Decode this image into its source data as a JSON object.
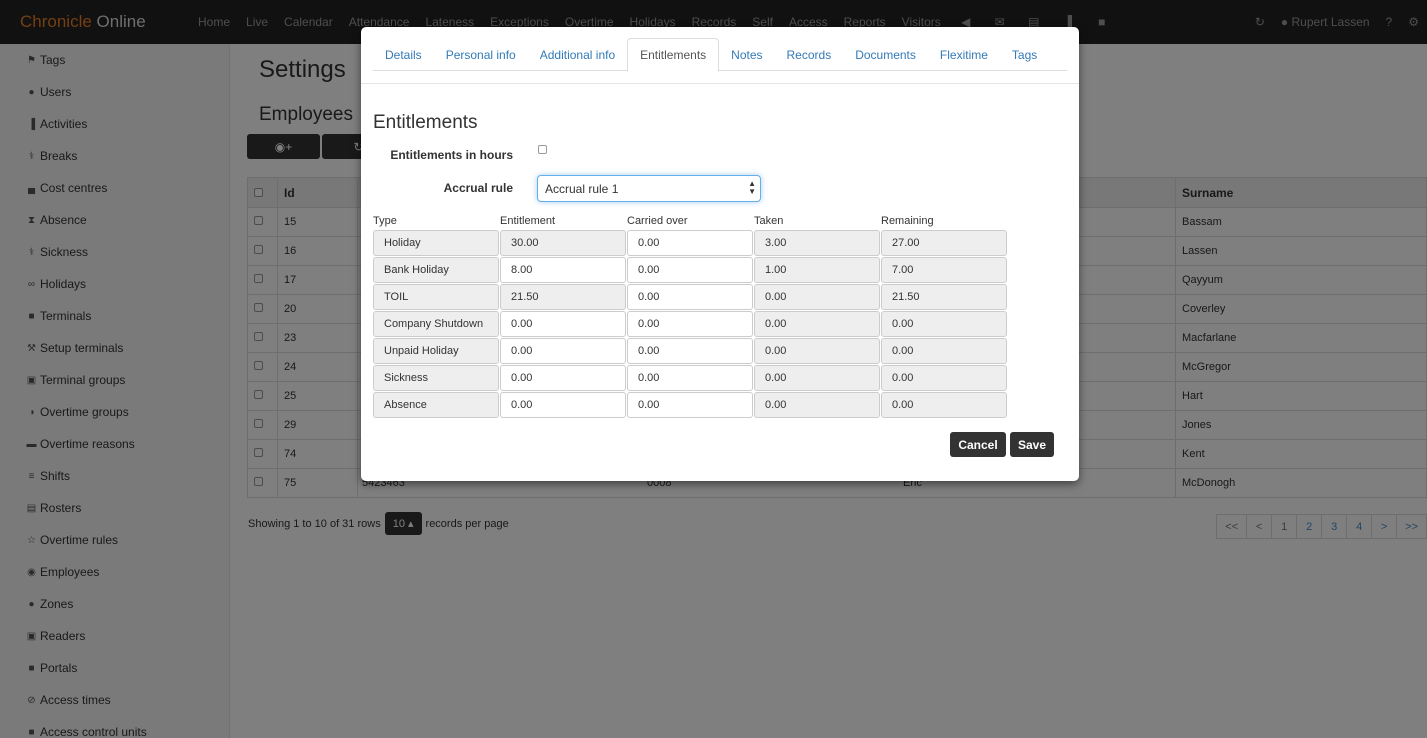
{
  "navbar": {
    "brand_main": "Chronicle",
    "brand_sub": "Online",
    "items": [
      "Home",
      "Live",
      "Calendar",
      "Attendance",
      "Lateness",
      "Exceptions",
      "Overtime",
      "Holidays",
      "Records",
      "Self",
      "Access",
      "Reports",
      "Visitors"
    ],
    "icons": [
      "speaker-icon",
      "envelope-icon",
      "document-icon",
      "sitemap-icon",
      "lock-icon"
    ],
    "user_name": "Rupert Lassen"
  },
  "sidebar": {
    "items": [
      {
        "label": "Tags",
        "icon": "tags-icon",
        "glyph": "⚑"
      },
      {
        "label": "Users",
        "icon": "user-icon",
        "glyph": "●"
      },
      {
        "label": "Activities",
        "icon": "bar-chart-icon",
        "glyph": "▐"
      },
      {
        "label": "Breaks",
        "icon": "cutlery-icon",
        "glyph": "⚕"
      },
      {
        "label": "Cost centres",
        "icon": "signal-icon",
        "glyph": "▄"
      },
      {
        "label": "Absence",
        "icon": "hourglass-icon",
        "glyph": "⧗"
      },
      {
        "label": "Sickness",
        "icon": "pill-icon",
        "glyph": "⚕"
      },
      {
        "label": "Holidays",
        "icon": "sunglasses-icon",
        "glyph": "∞"
      },
      {
        "label": "Terminals",
        "icon": "file-icon",
        "glyph": "■"
      },
      {
        "label": "Setup terminals",
        "icon": "wrench-icon",
        "glyph": "⚒"
      },
      {
        "label": "Terminal groups",
        "icon": "files-icon",
        "glyph": "▣"
      },
      {
        "label": "Overtime groups",
        "icon": "adjust-icon",
        "glyph": "◑"
      },
      {
        "label": "Overtime reasons",
        "icon": "comment-icon",
        "glyph": "▬"
      },
      {
        "label": "Shifts",
        "icon": "list-icon",
        "glyph": "≡"
      },
      {
        "label": "Rosters",
        "icon": "calendar-icon",
        "glyph": "▤"
      },
      {
        "label": "Overtime rules",
        "icon": "star-icon",
        "glyph": "☆"
      },
      {
        "label": "Employees",
        "icon": "eye-icon",
        "glyph": "◉"
      },
      {
        "label": "Zones",
        "icon": "globe-icon",
        "glyph": "●"
      },
      {
        "label": "Readers",
        "icon": "reader-icon",
        "glyph": "▣"
      },
      {
        "label": "Portals",
        "icon": "portal-icon",
        "glyph": "■"
      },
      {
        "label": "Access times",
        "icon": "ban-icon",
        "glyph": "⊘"
      },
      {
        "label": "Access control units",
        "icon": "file-icon",
        "glyph": "■"
      }
    ]
  },
  "main": {
    "title": "Settings",
    "subtitle": "Employees",
    "table": {
      "headers": [
        "Id",
        "Surname"
      ],
      "rows": [
        {
          "id": "15",
          "surname": "Bassam"
        },
        {
          "id": "16",
          "surname": "Lassen"
        },
        {
          "id": "17",
          "surname": "Qayyum"
        },
        {
          "id": "20",
          "surname": "Coverley"
        },
        {
          "id": "23",
          "surname": "Macfarlane"
        },
        {
          "id": "24",
          "surname": "McGregor"
        },
        {
          "id": "25",
          "surname": "Hart"
        },
        {
          "id": "29",
          "surname": "Jones"
        },
        {
          "id": "74",
          "surname": "Kent"
        },
        {
          "id": "75",
          "surname": "McDonogh",
          "badge": "5423463",
          "code": "0008",
          "forename": "Eric"
        }
      ]
    },
    "footer": {
      "showing": "Showing 1 to 10 of 31 rows",
      "per_page": "10 ▴",
      "records_per_page": "records per page"
    },
    "pager": [
      "<<",
      "<",
      "1",
      "2",
      "3",
      "4",
      ">",
      ">>"
    ]
  },
  "modal": {
    "tabs": [
      "Details",
      "Personal info",
      "Additional info",
      "Entitlements",
      "Notes",
      "Records",
      "Documents",
      "Flexitime",
      "Tags"
    ],
    "active_tab": "Entitlements",
    "heading": "Entitlements",
    "hours_label": "Entitlements in hours",
    "accrual_label": "Accrual rule",
    "accrual_value": "Accrual rule 1",
    "columns": [
      "Type",
      "Entitlement",
      "Carried over",
      "Taken",
      "Remaining"
    ],
    "rows": [
      {
        "type": "Holiday",
        "entitlement": "30.00",
        "carried": "0.00",
        "taken": "3.00",
        "remaining": "27.00"
      },
      {
        "type": "Bank Holiday",
        "entitlement": "8.00",
        "carried": "0.00",
        "taken": "1.00",
        "remaining": "7.00"
      },
      {
        "type": "TOIL",
        "entitlement": "21.50",
        "carried": "0.00",
        "taken": "0.00",
        "remaining": "21.50"
      },
      {
        "type": "Company Shutdown",
        "entitlement": "0.00",
        "carried": "0.00",
        "taken": "0.00",
        "remaining": "0.00"
      },
      {
        "type": "Unpaid Holiday",
        "entitlement": "0.00",
        "carried": "0.00",
        "taken": "0.00",
        "remaining": "0.00"
      },
      {
        "type": "Sickness",
        "entitlement": "0.00",
        "carried": "0.00",
        "taken": "0.00",
        "remaining": "0.00"
      },
      {
        "type": "Absence",
        "entitlement": "0.00",
        "carried": "0.00",
        "taken": "0.00",
        "remaining": "0.00"
      }
    ],
    "cancel_label": "Cancel",
    "save_label": "Save"
  }
}
